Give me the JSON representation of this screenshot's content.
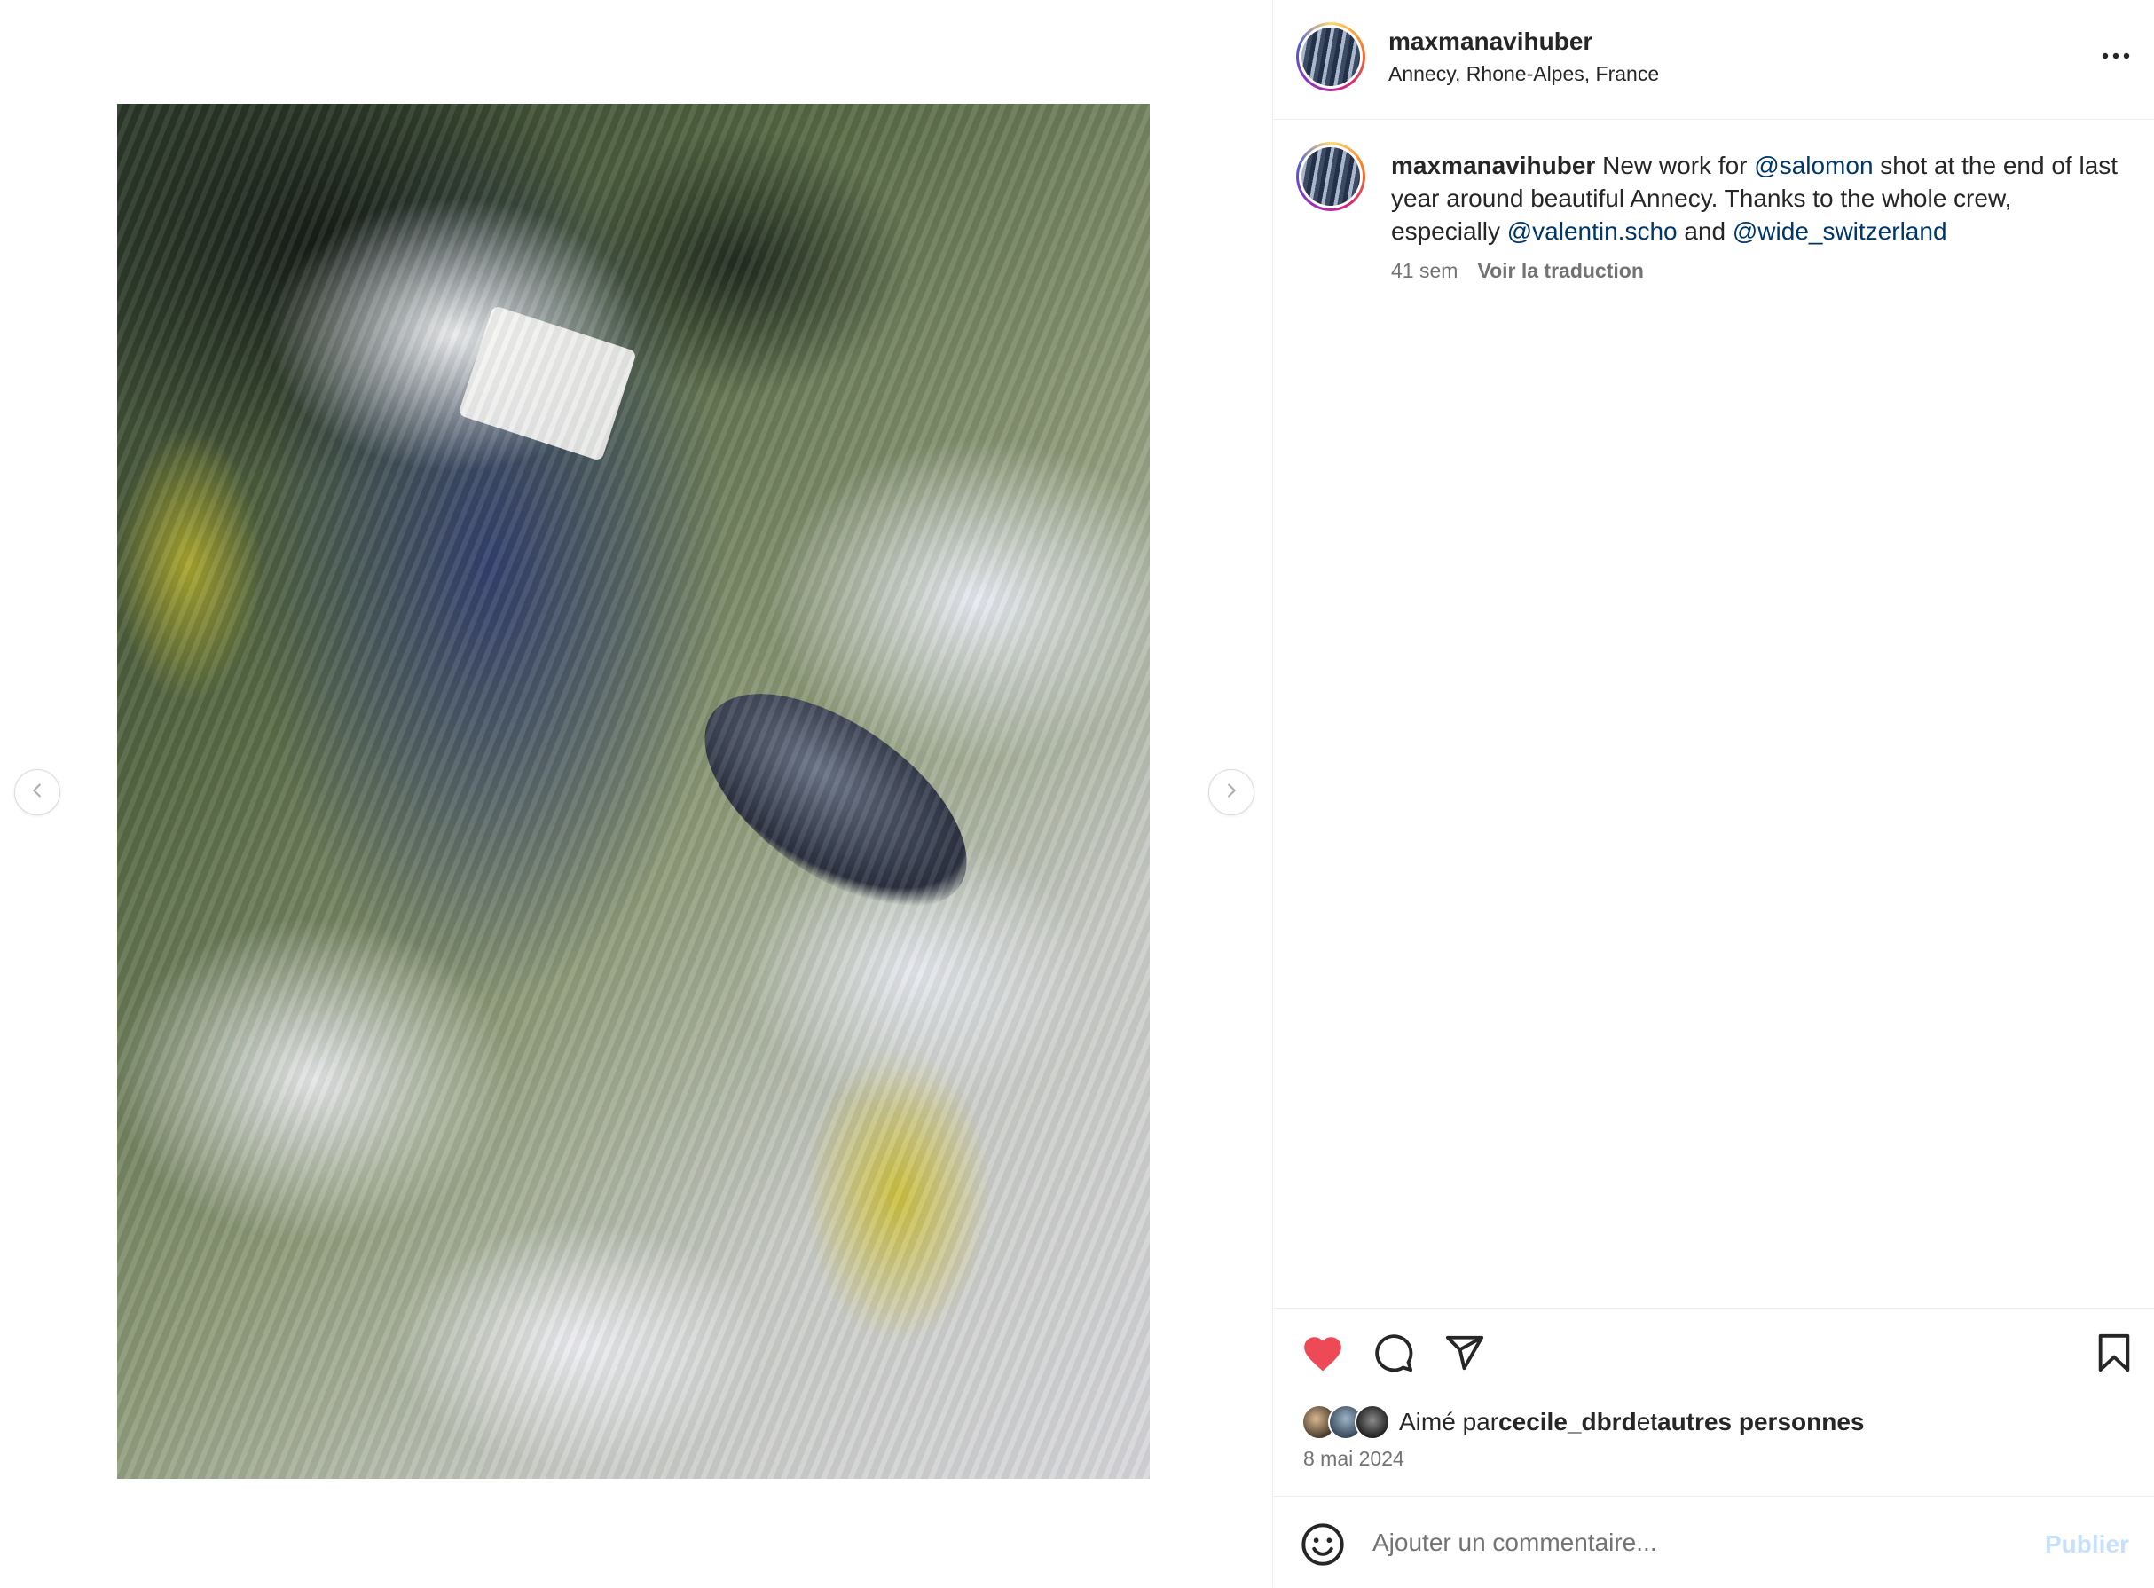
{
  "colors": {
    "like_active": "#ed4956",
    "mention": "#00376b",
    "muted_text": "#737373",
    "publish_disabled": "#c7e0fb",
    "divider": "#efefef"
  },
  "media": {
    "prev_icon": "chevron-left-icon",
    "next_icon": "chevron-right-icon"
  },
  "header": {
    "username": "maxmanavihuber",
    "location": "Annecy, Rhone-Alpes, France",
    "more_icon": "more-horizontal-icon"
  },
  "caption": {
    "username": "maxmanavihuber",
    "text_1": " New work for ",
    "mention_1": "@salomon",
    "text_2": " shot at the end of last year around beautiful Annecy. Thanks to the whole crew, especially ",
    "mention_2": "@valentin.scho",
    "text_3": " and ",
    "mention_3": "@wide_switzerland",
    "age": "41 sem",
    "translate_label": "Voir la traduction"
  },
  "actions": {
    "like_icon": "heart-icon",
    "liked": true,
    "comment_icon": "comment-icon",
    "share_icon": "send-icon",
    "save_icon": "bookmark-icon"
  },
  "likes": {
    "prefix": "Aimé par ",
    "user": "cecile_dbrd",
    "connector": " et ",
    "others": "autres personnes"
  },
  "post_date": "8 mai 2024",
  "comment": {
    "emoji_icon": "emoji-icon",
    "placeholder": "Ajouter un commentaire...",
    "value": "",
    "publish_label": "Publier"
  }
}
